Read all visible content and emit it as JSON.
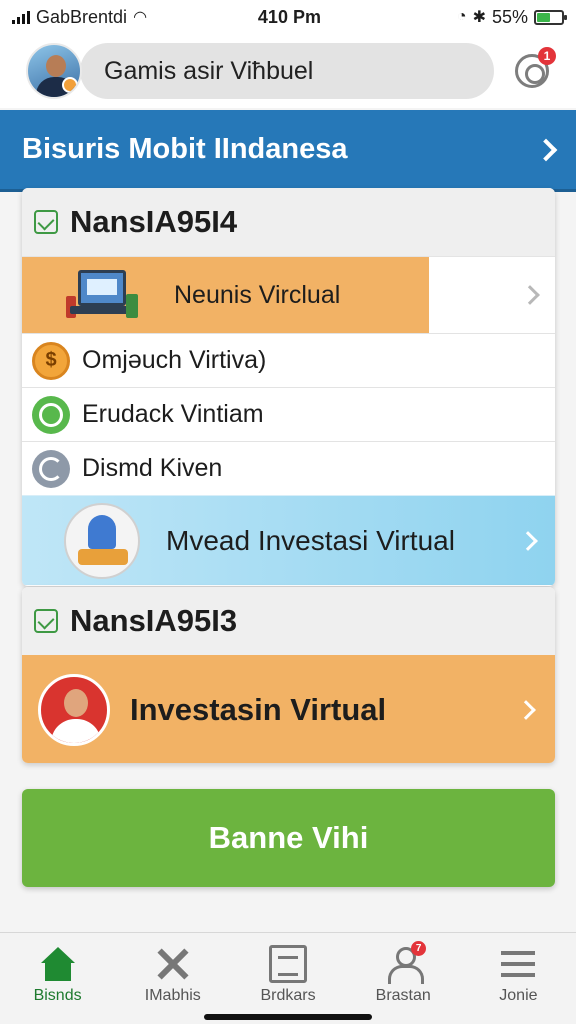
{
  "status_bar": {
    "carrier": "GabBrentdi",
    "time": "410 Pm",
    "battery": "55%",
    "battery_level": 0.55
  },
  "header": {
    "search_text": "Gamis asir Viħbuel",
    "notification_count": "1"
  },
  "banner": {
    "title": "Bisuris Mobit IIndanesa"
  },
  "card1": {
    "title": "NansIA95I4",
    "featured_label": "Neunis Virclual",
    "items": [
      {
        "label": "Omjəuch Virtiva)",
        "icon": "coin-icon"
      },
      {
        "label": "Erudack Vintiam",
        "icon": "search-icon"
      },
      {
        "label": "Dismd Kiven",
        "icon": "refresh-icon"
      }
    ],
    "promo_label": "Mvead Investasi Virtual"
  },
  "card2": {
    "title": "NansIA95I3",
    "promo_label": "Investasin Virtual"
  },
  "cta": {
    "label": "Banne Vihi"
  },
  "tabs": [
    {
      "label": "Bisnds",
      "icon": "home-icon"
    },
    {
      "label": "IMabhis",
      "icon": "tools-icon"
    },
    {
      "label": "Brdkars",
      "icon": "document-icon"
    },
    {
      "label": "Brastan",
      "icon": "user-icon",
      "badge": "7"
    },
    {
      "label": "Jonie",
      "icon": "menu-icon"
    }
  ],
  "colors": {
    "banner": "#2678b8",
    "accent_orange": "#f2b265",
    "cta_green": "#6cb43f",
    "active_tab": "#1e7a2e"
  }
}
